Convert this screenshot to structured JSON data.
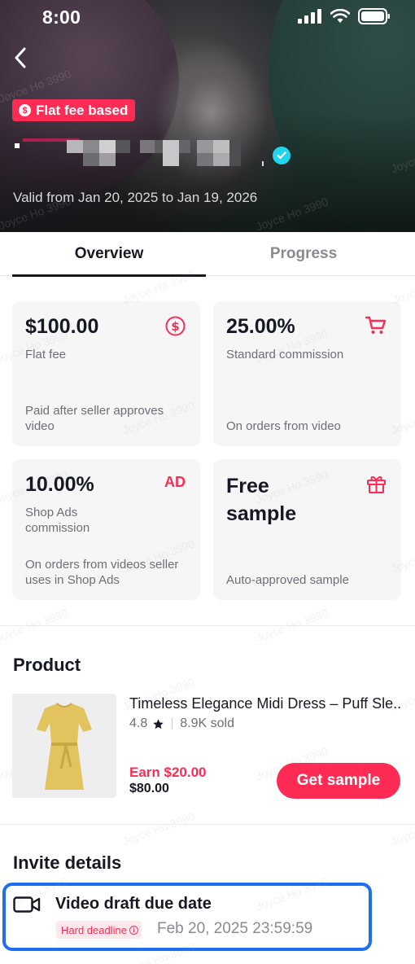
{
  "status_bar": {
    "time": "8:00"
  },
  "hero": {
    "badge": "Flat fee based",
    "valid_range": "Valid from Jan 20, 2025 to Jan 19, 2026"
  },
  "tabs": [
    {
      "label": "Overview",
      "active": true
    },
    {
      "label": "Progress",
      "active": false
    }
  ],
  "cards": [
    {
      "value": "$100.00",
      "label": "Flat fee",
      "note": "Paid after seller approves video",
      "icon": "dollar-circle-icon"
    },
    {
      "value": "25.00%",
      "label": "Standard commission",
      "note": "On orders from video",
      "icon": "cart-icon"
    },
    {
      "value": "10.00%",
      "label": "Shop Ads commission",
      "note": "On orders from videos seller uses in Shop Ads",
      "icon": "AD"
    },
    {
      "value": "Free sample",
      "label": "",
      "note": "Auto-approved sample",
      "icon": "gift-icon"
    }
  ],
  "product_section": {
    "title": "Product",
    "name": "Timeless Elegance Midi Dress – Puff Sle...",
    "rating": "4.8",
    "sold": "8.9K sold",
    "earn": "Earn $20.00",
    "price": "$80.00",
    "button": "Get sample"
  },
  "invite_section": {
    "title": "Invite details",
    "draft_title": "Video draft due date",
    "deadline_badge": "Hard deadline",
    "due_date": "Feb 20, 2025 23:59:59"
  },
  "watermark": "Joyce Ho 3990",
  "colors": {
    "accent": "#fe2c55",
    "verified": "#20d5ec",
    "highlight": "#1f6df2"
  }
}
